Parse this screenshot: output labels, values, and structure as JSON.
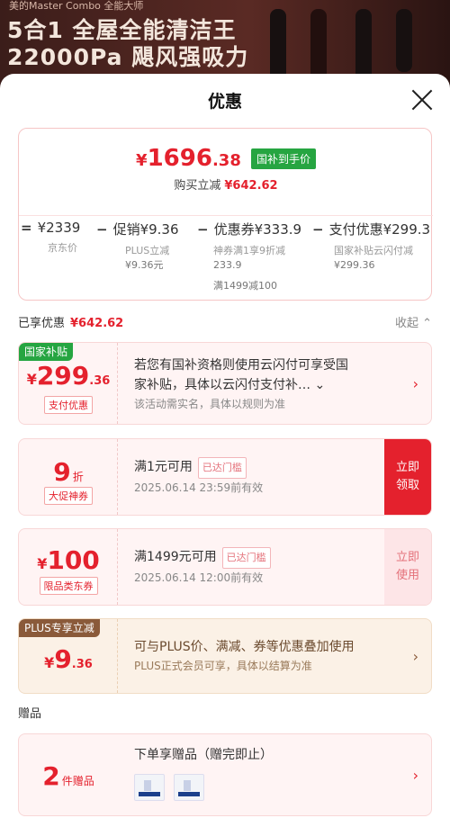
{
  "banner": {
    "subtitle": "美的Master Combo 全能大师",
    "line1": "5合1 全屋全能清洁王",
    "line2": "22000Pa 飓风强吸力"
  },
  "sheet": {
    "title": "优惠"
  },
  "summary": {
    "currency": "¥",
    "price_int": "1696",
    "price_dec": ".38",
    "price_tag": "国补到手价",
    "instant_label": "购买立减",
    "instant_amount": "¥642.62",
    "breakdown": [
      {
        "op": "=",
        "main": "¥2339",
        "sub": "京东价",
        "sub2": "",
        "sub3": ""
      },
      {
        "op": "−",
        "main": "促销¥9.36",
        "sub": "PLUS立减",
        "sub2": "¥9.36元",
        "sub3": ""
      },
      {
        "op": "−",
        "main": "优惠券¥333.9",
        "sub": "神券满1享9折减",
        "sub2": "233.9",
        "sub3": "满1499减100"
      },
      {
        "op": "−",
        "main": "支付优惠¥299.3",
        "sub": "国家补贴云闪付减",
        "sub2": "¥299.36",
        "sub3": ""
      }
    ]
  },
  "enjoyed": {
    "label": "已享优惠",
    "amount": "¥642.62",
    "collapse_label": "收起 ⌃"
  },
  "cards": {
    "subsidy": {
      "badge": "国家补贴",
      "yen": "¥",
      "int": "299",
      "dec": ".36",
      "tag": "支付优惠",
      "line1": "若您有国补资格则使用云闪付可享受国",
      "line1b": "家补贴，具体以云闪付支付补… ⌄",
      "line2": "该活动需实名，具体以规则为准"
    },
    "discount": {
      "int": "9",
      "unit": "折",
      "tag": "大促神券",
      "line1": "满1元可用",
      "chip": "已达门槛",
      "line2": "2025.06.14 23:59前有效",
      "cta": "立即领取"
    },
    "coupon100": {
      "yen": "¥",
      "int": "100",
      "tag": "限品类东券",
      "line1": "满1499元可用",
      "chip": "已达门槛",
      "line2": "2025.06.14 12:00前有效",
      "cta": "立即使用"
    },
    "plus": {
      "badge": "PLUS专享立减",
      "yen": "¥",
      "int": "9",
      "dec": ".36",
      "line1": "可与PLUS价、满减、券等优惠叠加使用",
      "line2": "PLUS正式会员可享，具体以结算为准"
    },
    "gift": {
      "count": "2",
      "unit": "件赠品",
      "title": "下单享赠品（赠完即止）"
    }
  },
  "gift_section_label": "赠品",
  "icons": {
    "close": "close-icon",
    "chevron": "chevron-right-icon"
  },
  "colors": {
    "accent_red": "#e4212d",
    "subsidy_green": "#26a541",
    "plus_brown": "#8a5a3a"
  }
}
